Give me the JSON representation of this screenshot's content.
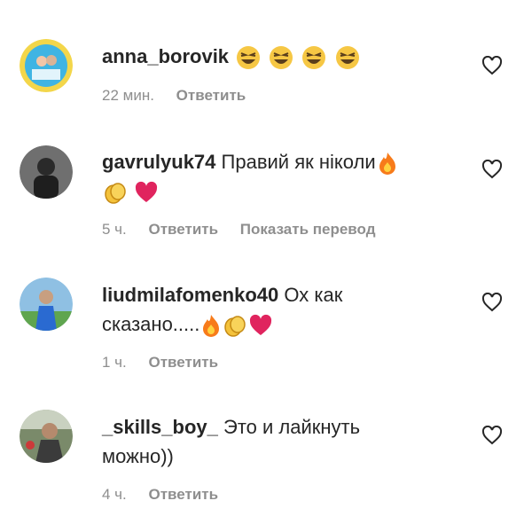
{
  "comments": [
    {
      "username": "anna_borovik",
      "text": "",
      "text_line2": "",
      "emojis": [
        "grinning-squinting-face",
        "grinning-squinting-face",
        "grinning-squinting-face",
        "grinning-squinting-face"
      ],
      "time": "22 мин.",
      "reply_label": "Ответить",
      "translate_label": ""
    },
    {
      "username": "gavrulyuk74",
      "text": "Правий як ніколи",
      "text_line2": "",
      "emojis": [
        "fire",
        "clapping-hands",
        "red-heart"
      ],
      "time": "5 ч.",
      "reply_label": "Ответить",
      "translate_label": "Показать перевод"
    },
    {
      "username": "liudmilafomenko40",
      "text": "Ох как",
      "text_line2": "сказано.....",
      "emojis": [
        "fire",
        "clapping-hands",
        "red-heart"
      ],
      "time": "1 ч.",
      "reply_label": "Ответить",
      "translate_label": ""
    },
    {
      "username": "_skills_boy_",
      "text": "Это и лайкнуть",
      "text_line2": "можно))",
      "emojis": [],
      "time": "4 ч.",
      "reply_label": "Ответить",
      "translate_label": ""
    }
  ],
  "colors": {
    "text": "#262626",
    "secondary": "#8e8e8e",
    "heart": "#e0245e",
    "fire": "#f77b1a",
    "clap": "#f4c23b"
  },
  "icons": [
    "like-heart-icon",
    "avatar"
  ]
}
